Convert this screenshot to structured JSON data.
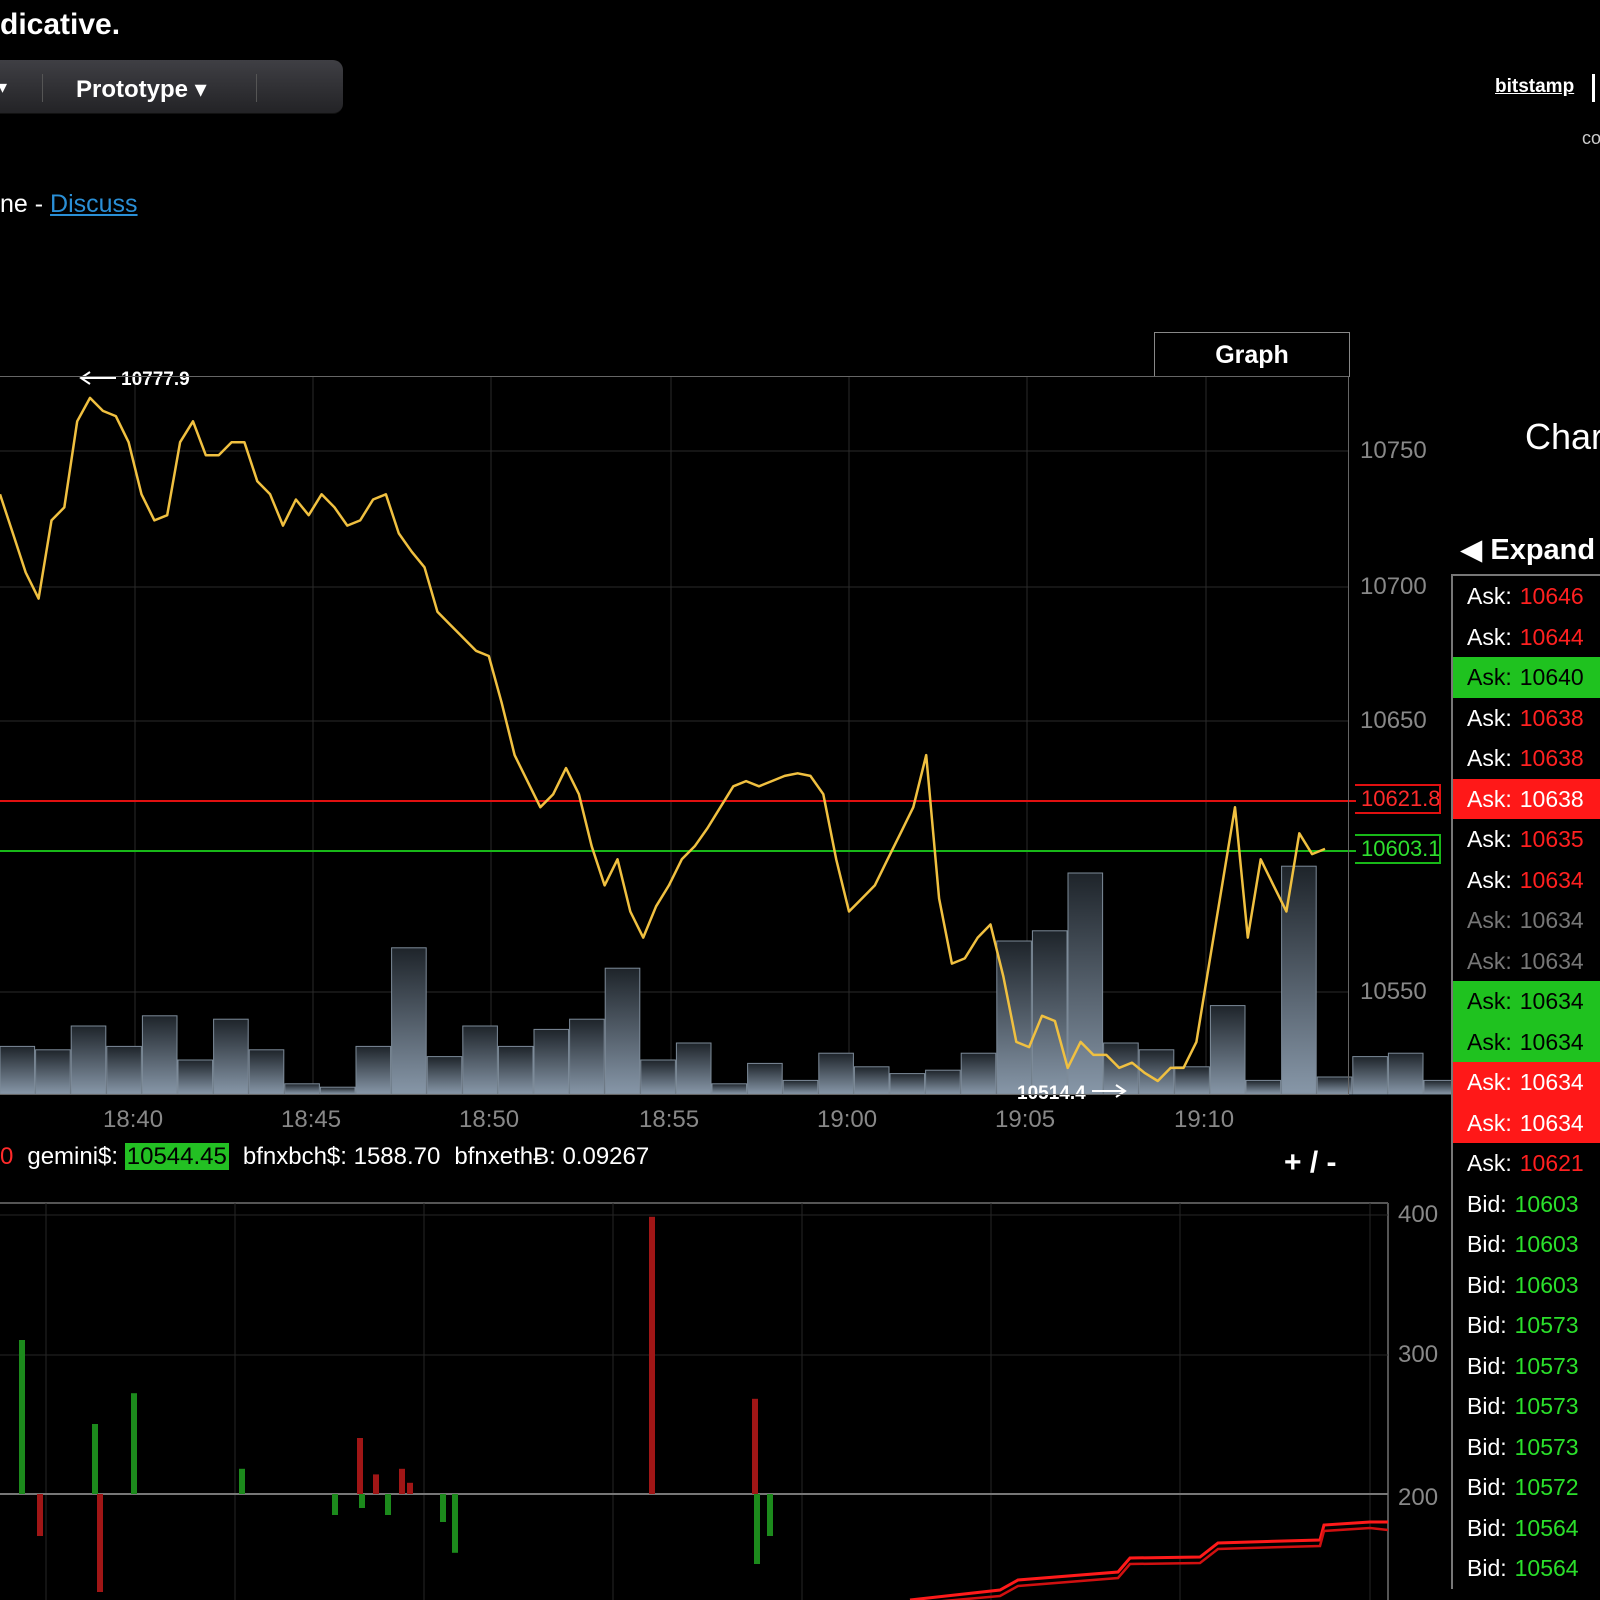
{
  "header": {
    "headline": "dicative.",
    "menu_prev_arrow": "▾",
    "menu_item": "Prototype ▾",
    "discuss_prefix": "ne - ",
    "discuss_link": "Discuss",
    "exchange_link": "bitstamp",
    "top_right_fragment": "co"
  },
  "chart": {
    "tab_label": "Graph",
    "high_label": "10777.9",
    "low_label": "10514.4",
    "ask_line_label": "10621.8",
    "bid_line_label": "10603.1",
    "zoom_control": "+ / -",
    "colors": {
      "price": "#f0c040",
      "ask_line": "#e01010",
      "bid_line": "#18b818",
      "volume": "#6d7c8c"
    }
  },
  "ticker": {
    "lead_fragment": "0",
    "items": [
      {
        "label": "gemini$:",
        "value": "10544.45"
      },
      {
        "label": "bfnxbch$:",
        "value": "1588.70"
      },
      {
        "label": "bfnxethɃ:",
        "value": "0.09267"
      }
    ]
  },
  "sidebar": {
    "title_fragment": "Char",
    "expand_label": "◀ Expand",
    "book": [
      {
        "side": "Ask:",
        "value": "10646",
        "style": "ask"
      },
      {
        "side": "Ask:",
        "value": "10644",
        "style": "ask"
      },
      {
        "side": "Ask:",
        "value": "10640",
        "style": "ask hl-green"
      },
      {
        "side": "Ask:",
        "value": "10638",
        "style": "ask"
      },
      {
        "side": "Ask:",
        "value": "10638",
        "style": "ask"
      },
      {
        "side": "Ask:",
        "value": "10638",
        "style": "ask hl-red"
      },
      {
        "side": "Ask:",
        "value": "10635",
        "style": "ask"
      },
      {
        "side": "Ask:",
        "value": "10634",
        "style": "ask"
      },
      {
        "side": "Ask:",
        "value": "10634",
        "style": "ask dim"
      },
      {
        "side": "Ask:",
        "value": "10634",
        "style": "ask dim"
      },
      {
        "side": "Ask:",
        "value": "10634",
        "style": "ask hl-green"
      },
      {
        "side": "Ask:",
        "value": "10634",
        "style": "ask hl-green"
      },
      {
        "side": "Ask:",
        "value": "10634",
        "style": "ask hl-red"
      },
      {
        "side": "Ask:",
        "value": "10634",
        "style": "ask hl-red"
      },
      {
        "side": "Ask:",
        "value": "10621",
        "style": "ask"
      },
      {
        "side": "Bid:",
        "value": "10603",
        "style": "bid"
      },
      {
        "side": "Bid:",
        "value": "10603",
        "style": "bid"
      },
      {
        "side": "Bid:",
        "value": "10603",
        "style": "bid"
      },
      {
        "side": "Bid:",
        "value": "10573",
        "style": "bid"
      },
      {
        "side": "Bid:",
        "value": "10573",
        "style": "bid"
      },
      {
        "side": "Bid:",
        "value": "10573",
        "style": "bid"
      },
      {
        "side": "Bid:",
        "value": "10573",
        "style": "bid"
      },
      {
        "side": "Bid:",
        "value": "10572",
        "style": "bid"
      },
      {
        "side": "Bid:",
        "value": "10564",
        "style": "bid"
      },
      {
        "side": "Bid:",
        "value": "10564",
        "style": "bid"
      }
    ]
  },
  "chart_data": [
    {
      "type": "line",
      "ylim": [
        10510,
        10785
      ],
      "yticks": [
        "10750",
        "10700",
        "10650",
        "10550"
      ],
      "xticks": [
        "18:40",
        "18:45",
        "18:50",
        "18:55",
        "19:00",
        "19:05",
        "19:10"
      ],
      "series": [
        {
          "values": [
            10740,
            10725,
            10710,
            10700,
            10730,
            10735,
            10768,
            10777,
            10772,
            10770,
            10760,
            10740,
            10730,
            10732,
            10760,
            10768,
            10755,
            10755,
            10760,
            10760,
            10745,
            10740,
            10728,
            10738,
            10732,
            10740,
            10735,
            10728,
            10730,
            10738,
            10740,
            10725,
            10718,
            10712,
            10695,
            10690,
            10685,
            10680,
            10678,
            10660,
            10640,
            10630,
            10620,
            10625,
            10635,
            10625,
            10605,
            10590,
            10600,
            10580,
            10570,
            10582,
            10590,
            10600,
            10605,
            10612,
            10620,
            10628,
            10630,
            10628,
            10630,
            10632,
            10633,
            10632,
            10625,
            10600,
            10580,
            10585,
            10590,
            10600,
            10610,
            10620,
            10640,
            10585,
            10560,
            10562,
            10570,
            10575,
            10555,
            10530,
            10528,
            10540,
            10538,
            10520,
            10530,
            10525,
            10525,
            10520,
            10522,
            10518,
            10515,
            10520,
            10520,
            10530,
            10560,
            10590,
            10620,
            10570,
            10600,
            10590,
            10580,
            10610,
            10602,
            10604
          ]
        }
      ]
    },
    {
      "type": "bar",
      "series": [
        {
          "name": "volume",
          "values": [
            14,
            13,
            20,
            14,
            23,
            10,
            22,
            13,
            3,
            2,
            14,
            43,
            11,
            20,
            14,
            19,
            22,
            37,
            10,
            15,
            3,
            9,
            4,
            12,
            8,
            6,
            7,
            12,
            45,
            48,
            65,
            15,
            13,
            8,
            26,
            4,
            67,
            5,
            11,
            12,
            4
          ]
        }
      ]
    },
    {
      "type": "bar",
      "ylim": [
        150,
        410
      ],
      "yticks": [
        "400",
        "300",
        "200"
      ],
      "series": [
        {
          "name": "green",
          "values": [
            [
              22,
              310
            ],
            [
              95,
              250
            ],
            [
              134,
              272
            ],
            [
              242,
              218
            ],
            [
              335,
              185
            ],
            [
              362,
              190
            ],
            [
              388,
              185
            ],
            [
              443,
              180
            ],
            [
              455,
              158
            ],
            [
              757,
              150
            ],
            [
              770,
              170
            ]
          ]
        },
        {
          "name": "red",
          "values": [
            [
              40,
              170
            ],
            [
              100,
              130
            ],
            [
              360,
              240
            ],
            [
              376,
              214
            ],
            [
              402,
              218
            ],
            [
              410,
              208
            ],
            [
              652,
              398
            ],
            [
              755,
              268
            ]
          ]
        }
      ]
    }
  ]
}
